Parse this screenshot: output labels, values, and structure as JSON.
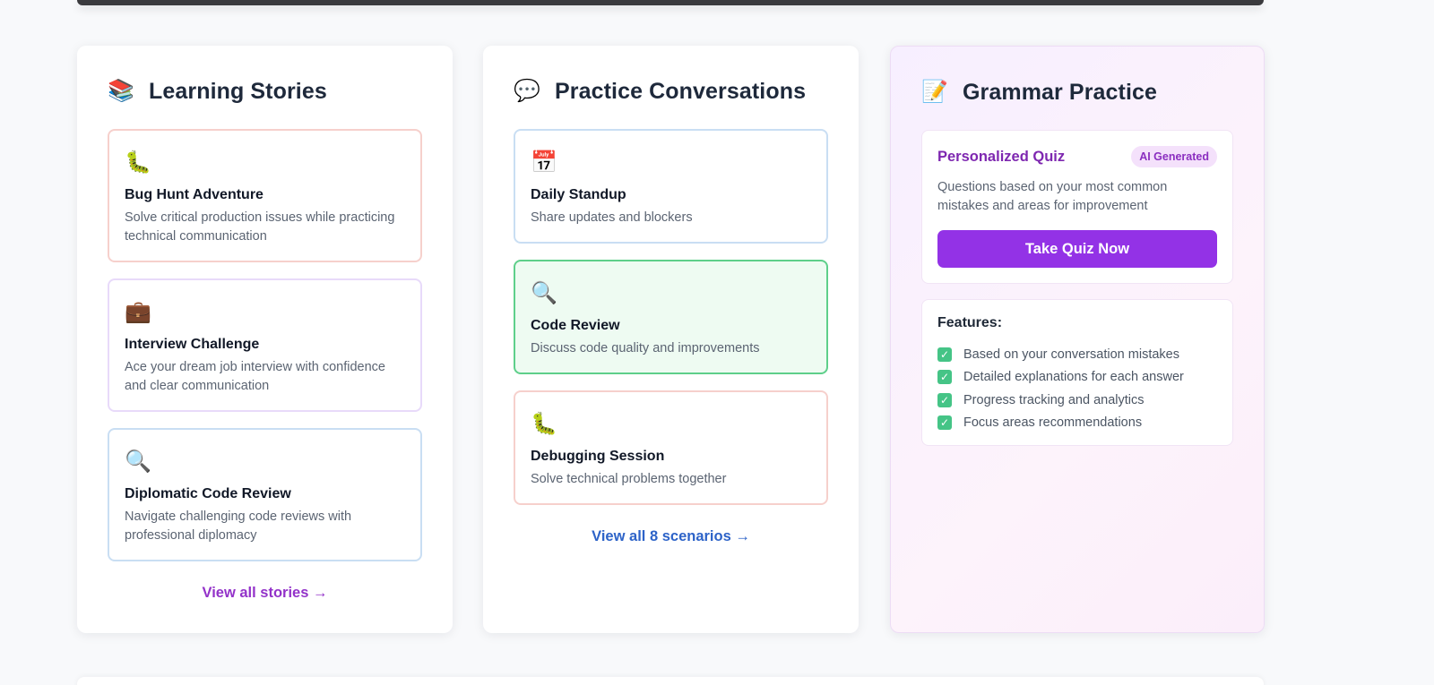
{
  "stories": {
    "icon": "books-icon",
    "icon_glyph": "📚",
    "title": "Learning Stories",
    "items": [
      {
        "icon": "caterpillar-icon",
        "glyph": "🐛",
        "title": "Bug Hunt Adventure",
        "desc": "Solve critical production issues while practicing technical communication"
      },
      {
        "icon": "briefcase-icon",
        "glyph": "💼",
        "title": "Interview Challenge",
        "desc": "Ace your dream job interview with confidence and clear communication"
      },
      {
        "icon": "magnifier-icon",
        "glyph": "🔍",
        "title": "Diplomatic Code Review",
        "desc": "Navigate challenging code reviews with professional diplomacy"
      }
    ],
    "link": "View all stories →"
  },
  "conversations": {
    "icon": "speech-bubble-icon",
    "icon_glyph": "💬",
    "title": "Practice Conversations",
    "items": [
      {
        "icon": "calendar-icon",
        "glyph": "📅",
        "title": "Daily Standup",
        "desc": "Share updates and blockers"
      },
      {
        "icon": "magnifier-icon",
        "glyph": "🔍",
        "title": "Code Review",
        "desc": "Discuss code quality and improvements",
        "selected": true
      },
      {
        "icon": "caterpillar-icon",
        "glyph": "🐛",
        "title": "Debugging Session",
        "desc": "Solve technical problems together"
      }
    ],
    "link": "View all 8 scenarios →"
  },
  "grammar": {
    "icon": "memo-icon",
    "icon_glyph": "📝",
    "title": "Grammar Practice",
    "quiz": {
      "title": "Personalized Quiz",
      "badge": "AI Generated",
      "desc": "Questions based on your most common mistakes and areas for improvement",
      "button": "Take Quiz Now"
    },
    "features": {
      "heading": "Features:",
      "check_glyph": "✓",
      "items": [
        "Based on your conversation mistakes",
        "Detailed explanations for each answer",
        "Progress tracking and analytics",
        "Focus areas recommendations"
      ]
    }
  },
  "colors": {
    "accent_purple": "#9332e6",
    "link_blue": "#2d63c8",
    "selected_green": "#5ecf8a",
    "check_green": "#45c486"
  }
}
